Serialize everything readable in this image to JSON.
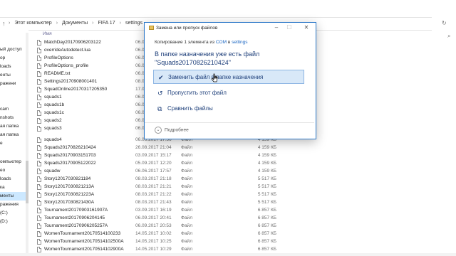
{
  "explorer": {
    "breadcrumb": [
      "Этот компьютер",
      "Документы",
      "FIFA 17",
      "settings"
    ],
    "column_name_header": "Имя",
    "sidebar_items": [
      {
        "label": "",
        "selected": false
      },
      {
        "label": "ый доступ",
        "selected": false
      },
      {
        "label": "ор",
        "selected": false
      },
      {
        "label": "loads",
        "selected": false
      },
      {
        "label": "енты",
        "selected": false
      },
      {
        "label": "ражени",
        "selected": false
      },
      {
        "label": "",
        "selected": false
      },
      {
        "label": "",
        "selected": false
      },
      {
        "label": "cam",
        "selected": false
      },
      {
        "label": "nshots",
        "selected": false
      },
      {
        "label": "ая папка",
        "selected": false
      },
      {
        "label": "ая папка",
        "selected": false
      },
      {
        "label": "e",
        "selected": false
      },
      {
        "label": "",
        "selected": false
      },
      {
        "label": "",
        "selected": false
      },
      {
        "label": "омпьютер",
        "selected": false
      },
      {
        "label": "ео",
        "selected": false
      },
      {
        "label": "loads",
        "selected": false
      },
      {
        "label": "ка",
        "selected": false
      },
      {
        "label": "менты",
        "selected": true
      },
      {
        "label": "ражения",
        "selected": false
      },
      {
        "label": "(C:)",
        "selected": false
      },
      {
        "label": "(D:)",
        "selected": false
      }
    ],
    "files": [
      {
        "name": "MatchDay20170906203122",
        "date": "06.0",
        "type": "",
        "size": ""
      },
      {
        "name": "overrideAutodetect.lua",
        "date": "06.0",
        "type": "",
        "size": ""
      },
      {
        "name": "ProfileOptions",
        "date": "06.0",
        "type": "",
        "size": ""
      },
      {
        "name": "ProfileOptions_profile",
        "date": "06.0",
        "type": "",
        "size": ""
      },
      {
        "name": "README.txt",
        "date": "06.0",
        "type": "",
        "size": ""
      },
      {
        "name": "Settings20170908001401",
        "date": "08.0",
        "type": "",
        "size": ""
      },
      {
        "name": "SquadOnline20170317205350",
        "date": "17.0",
        "type": "",
        "size": ""
      },
      {
        "name": "squads1",
        "date": "06.0",
        "type": "",
        "size": ""
      },
      {
        "name": "squads1b",
        "date": "06.0",
        "type": "",
        "size": ""
      },
      {
        "name": "squads1c",
        "date": "06.0",
        "type": "",
        "size": ""
      },
      {
        "name": "squads2",
        "date": "06.0",
        "type": "",
        "size": ""
      },
      {
        "name": "squads3",
        "date": "06.0",
        "type": "",
        "size": ""
      },
      {
        "name": "squads4",
        "date": "06.06.2017 17:56",
        "type": "Файл",
        "size": "4 159 КБ"
      },
      {
        "name": "Squads20170826210424",
        "date": "26.08.2017 21:04",
        "type": "Файл",
        "size": "4 159 КБ"
      },
      {
        "name": "Squads20170903151703",
        "date": "03.09.2017 15:17",
        "type": "Файл",
        "size": "4 159 КБ"
      },
      {
        "name": "Squads20170905122022",
        "date": "05.09.2017 12:20",
        "type": "Файл",
        "size": "4 159 КБ"
      },
      {
        "name": "squadw",
        "date": "06.06.2017 17:57",
        "type": "Файл",
        "size": "4 159 КБ"
      },
      {
        "name": "Story12017030821184",
        "date": "08.03.2017 21:18",
        "type": "Файл",
        "size": "5 517 КБ"
      },
      {
        "name": "Story12017030821213A",
        "date": "08.03.2017 21:21",
        "type": "Файл",
        "size": "5 517 КБ"
      },
      {
        "name": "Story12017030821223A",
        "date": "08.03.2017 21:22",
        "type": "Файл",
        "size": "5 517 КБ"
      },
      {
        "name": "Story12017030821430A",
        "date": "08.03.2017 21:43",
        "type": "Файл",
        "size": "5 517 КБ"
      },
      {
        "name": "Tournament20170903161907A",
        "date": "03.09.2017 16:19",
        "type": "Файл",
        "size": "6 857 КБ"
      },
      {
        "name": "Tournament20170906204145",
        "date": "06.09.2017 20:41",
        "type": "Файл",
        "size": "6 857 КБ"
      },
      {
        "name": "Tournament20170906205257A",
        "date": "06.09.2017 20:53",
        "type": "Файл",
        "size": "6 857 КБ"
      },
      {
        "name": "WomenTournament20170514100233",
        "date": "14.05.2017 10:02",
        "type": "Файл",
        "size": "6 857 КБ"
      },
      {
        "name": "WomenTournament20170514102500A",
        "date": "14.05.2017 10:25",
        "type": "Файл",
        "size": "6 857 КБ"
      },
      {
        "name": "WomenTournament20170514102900A",
        "date": "14.05.2017 10:29",
        "type": "Файл",
        "size": "6 857 КБ"
      }
    ]
  },
  "dialog": {
    "title": "Замена или пропуск файлов",
    "copy_prefix": "Копирование 1 элемента из",
    "copy_source": "COM",
    "copy_mid": "в",
    "copy_target": "settings",
    "headline_line1": "В папке назначения уже есть файл",
    "headline_line2": "\"Squads20170826210424\"",
    "options": [
      {
        "label": "Заменить файл в папке назначения",
        "icon": "check-icon"
      },
      {
        "label": "Пропустить этот файл",
        "icon": "skip-icon"
      },
      {
        "label": "Сравнить файлы",
        "icon": "compare-icon"
      }
    ],
    "details_label": "Подробнее"
  }
}
